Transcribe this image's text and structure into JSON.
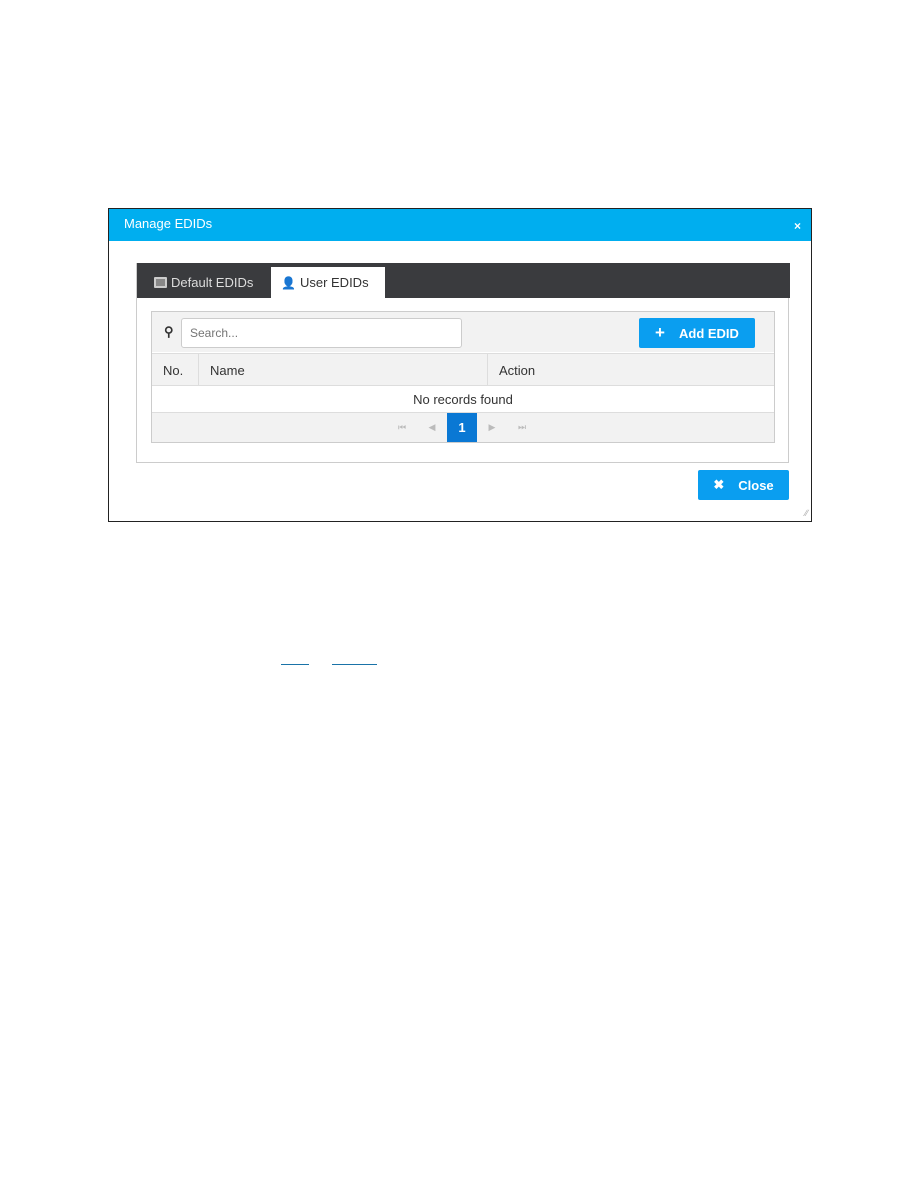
{
  "dialog": {
    "title": "Manage EDIDs",
    "close_icon": "×",
    "tabs": [
      {
        "label": "Default EDIDs",
        "icon": "monitor-icon",
        "active": false
      },
      {
        "label": "User EDIDs",
        "icon": "user-plus-icon",
        "active": true
      }
    ],
    "search": {
      "placeholder": "Search...",
      "value": ""
    },
    "add_button": {
      "label": "Add EDID",
      "icon": "+"
    },
    "table": {
      "columns": [
        "No.",
        "Name",
        "Action"
      ],
      "empty_message": "No records found"
    },
    "pagination": {
      "first": "⏮",
      "prev": "◀",
      "current": "1",
      "next": "▶",
      "last": "⏭"
    },
    "close_button": {
      "label": "Close",
      "icon": "✖"
    }
  },
  "colors": {
    "header": "#00aeef",
    "button": "#0a9ef0",
    "active_page": "#0a78d4",
    "tabbar": "#3a3b3e"
  }
}
